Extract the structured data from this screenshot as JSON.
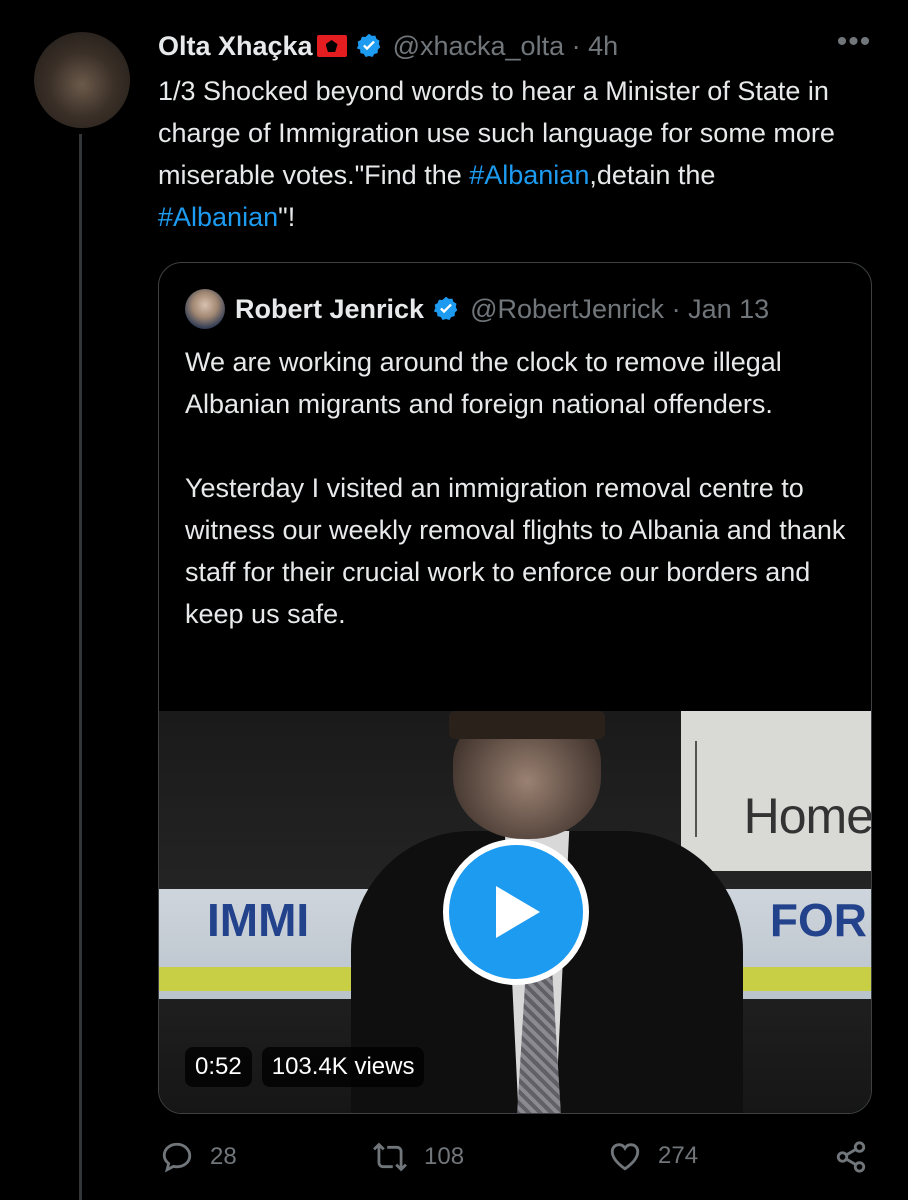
{
  "tweet": {
    "author_name": "Olta Xhaçka",
    "author_handle": "@xhacka_olta",
    "time": "4h",
    "text_parts": [
      "1/3 Shocked beyond words to hear a Minister of State in charge of Immigration use such language for some more miserable votes.\"Find the ",
      "#Albanian",
      ",detain the ",
      "#Albanian",
      "\"!"
    ]
  },
  "quoted": {
    "author_name": "Robert Jenrick",
    "author_handle": "@RobertJenrick",
    "date": "Jan 13",
    "text": "We are working around the clock to remove illegal Albanian migrants and foreign national offenders.\n\nYesterday I visited an immigration removal centre to witness our weekly removal flights to Albania and thank staff for their crucial work to enforce our borders and keep us safe.",
    "video": {
      "duration": "0:52",
      "views": "103.4K views",
      "scene_text_left": "IMMI",
      "scene_text_right": "FOR",
      "scene_sign": "Home"
    }
  },
  "actions": {
    "replies": "28",
    "retweets": "108",
    "likes": "274"
  },
  "colors": {
    "background": "#000000",
    "text": "#e7e9ea",
    "muted": "#71767b",
    "accent": "#1d9bf0"
  },
  "icons": [
    "more-icon",
    "verified-icon",
    "reply-icon",
    "retweet-icon",
    "like-icon",
    "share-icon",
    "play-icon",
    "flag-icon"
  ]
}
